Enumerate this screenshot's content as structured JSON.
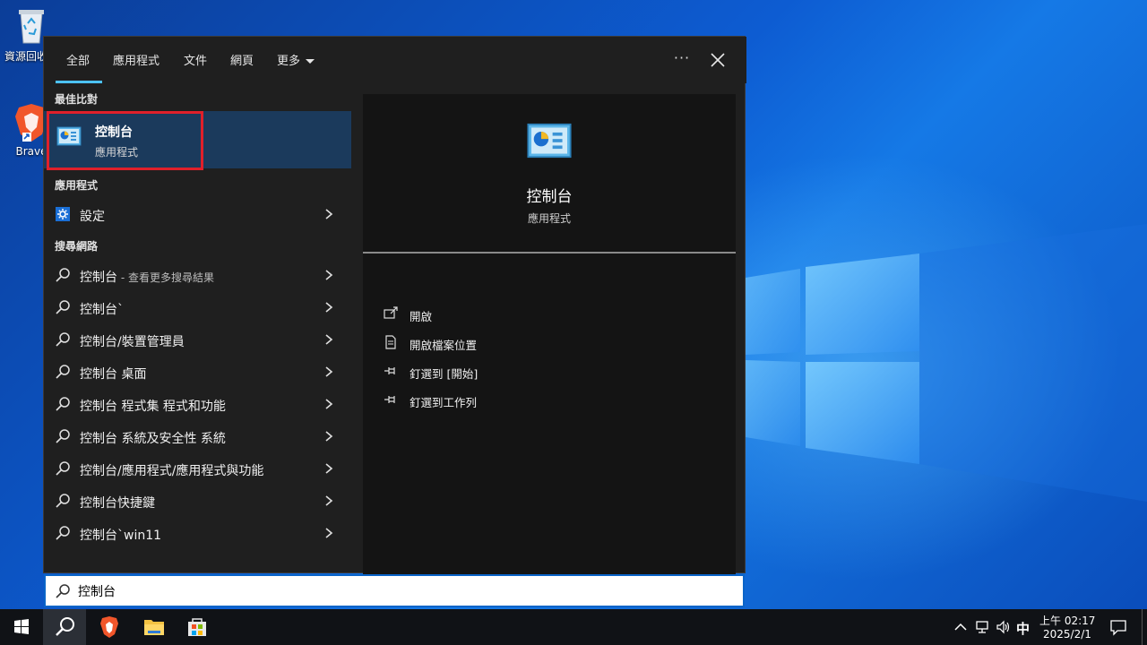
{
  "desktop": {
    "icons": [
      {
        "label": "資源回收筒"
      },
      {
        "label": "Brave"
      }
    ]
  },
  "panel": {
    "tabs": [
      {
        "label": "全部",
        "active": true
      },
      {
        "label": "應用程式"
      },
      {
        "label": "文件"
      },
      {
        "label": "網頁"
      },
      {
        "label": "更多"
      }
    ],
    "more_options": "···"
  },
  "results": {
    "best_match_label": "最佳比對",
    "best_match": {
      "title": "控制台",
      "subtitle": "應用程式",
      "icon": "control-panel-icon"
    },
    "apps_label": "應用程式",
    "apps": [
      {
        "label": "設定",
        "icon": "settings-gear-icon"
      }
    ],
    "web_label": "搜尋網路",
    "web": [
      {
        "label": "控制台",
        "suffix": " - 查看更多搜尋結果"
      },
      {
        "label": "控制台`",
        "suffix": ""
      },
      {
        "label": "控制台/裝置管理員",
        "suffix": ""
      },
      {
        "label": "控制台 桌面",
        "suffix": ""
      },
      {
        "label": "控制台 程式集 程式和功能",
        "suffix": ""
      },
      {
        "label": "控制台 系統及安全性 系統",
        "suffix": ""
      },
      {
        "label": "控制台/應用程式/應用程式與功能",
        "suffix": ""
      },
      {
        "label": "控制台快捷鍵",
        "suffix": ""
      },
      {
        "label": "控制台`win11",
        "suffix": ""
      }
    ]
  },
  "preview": {
    "title": "控制台",
    "subtitle": "應用程式",
    "actions": [
      {
        "label": "開啟",
        "icon": "open-icon"
      },
      {
        "label": "開啟檔案位置",
        "icon": "file-location-icon"
      },
      {
        "label": "釘選到 [開始]",
        "icon": "pin-icon"
      },
      {
        "label": "釘選到工作列",
        "icon": "pin-icon"
      }
    ]
  },
  "search": {
    "value": "控制台"
  },
  "taskbar": {
    "ime": "中",
    "time": "上午 02:17",
    "date": "2025/2/1"
  },
  "colors": {
    "accent": "#4cc2ff",
    "highlight": "#1b3a5c",
    "outline": "#e0202a"
  }
}
